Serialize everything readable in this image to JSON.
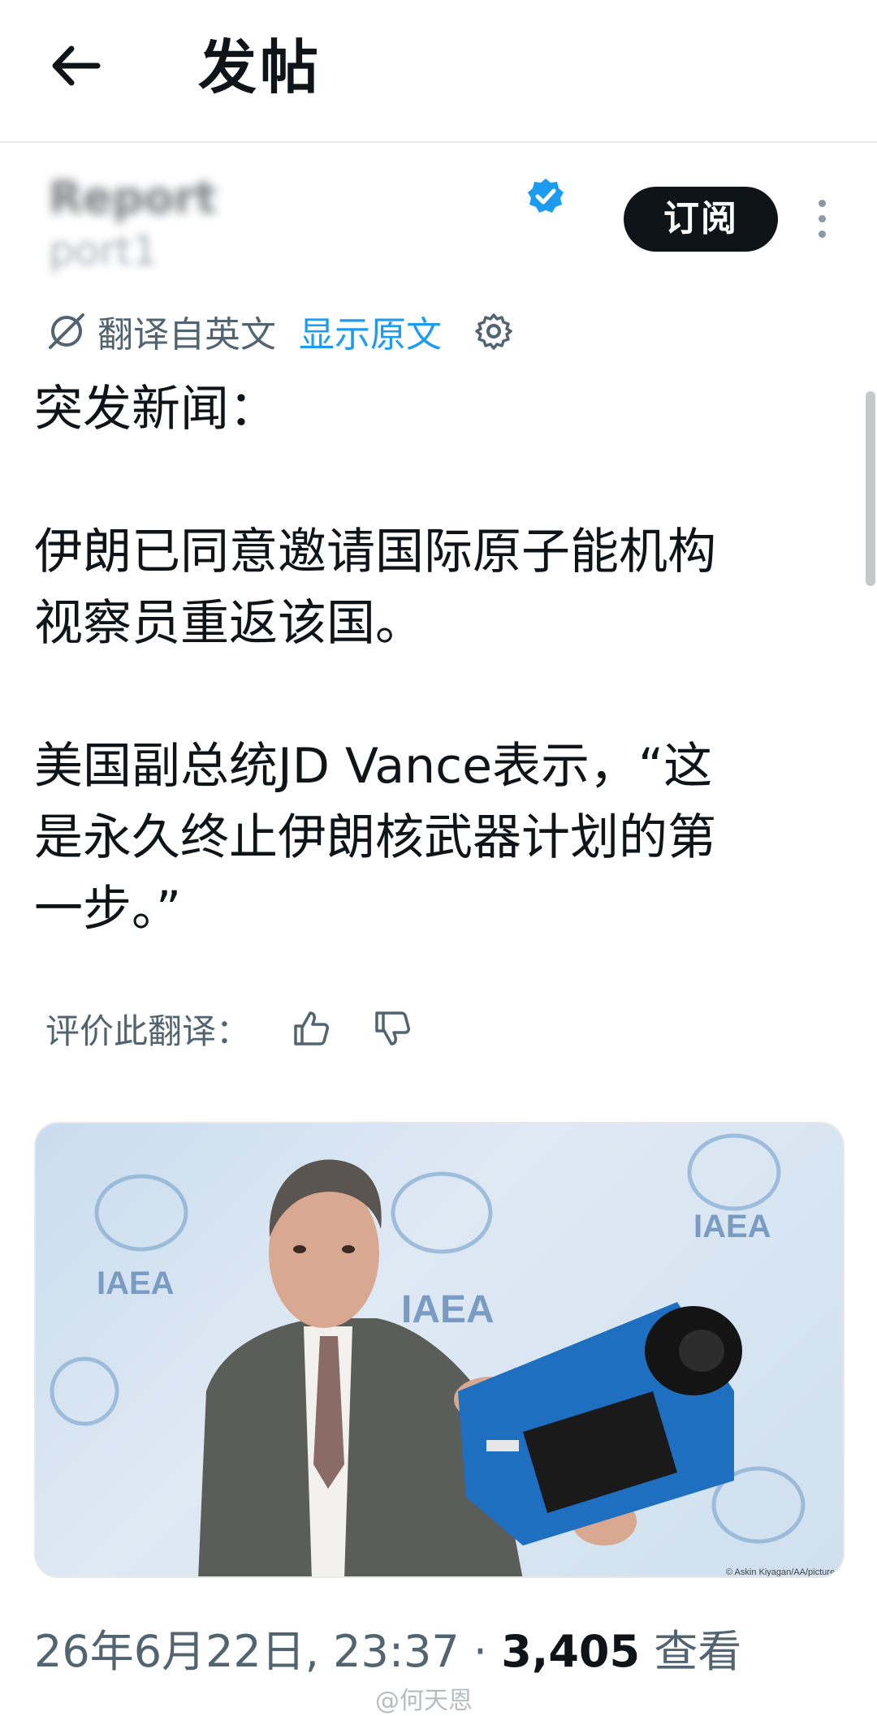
{
  "header": {
    "title": "发帖",
    "back_icon": "arrow-left-icon"
  },
  "author": {
    "name": "Report",
    "handle": "port1",
    "verified_icon": "verified-badge-icon",
    "verified_color": "#1d9bf0",
    "subscribe_label": "订阅",
    "more_icon": "more-vertical-icon"
  },
  "translation": {
    "label": "翻译自英文",
    "show_original": "显示原文",
    "translate_icon": "translate-icon",
    "settings_icon": "gear-icon",
    "link_color": "#1d9bf0"
  },
  "post": {
    "line1": "突发新闻：",
    "line2a": "伊朗已同意邀请国际原子能机构",
    "line2b": "视察员重返该国。",
    "line3a": "美国副总统JD Vance表示，“这",
    "line3b": "是永久终止伊朗核武器计划的第",
    "line3c": "一步。”"
  },
  "rating": {
    "label": "评价此翻译：",
    "thumbs_up_icon": "thumbs-up-icon",
    "thumbs_down_icon": "thumbs-down-icon"
  },
  "media": {
    "sign_text": "IAEA",
    "credit": "© Askin Kiyagan/AA/picture alliance"
  },
  "meta": {
    "date": "26年6月22日, 23:37 ·",
    "views_count": "3,405",
    "views_label": "查看"
  },
  "watermark": "@何天恩"
}
